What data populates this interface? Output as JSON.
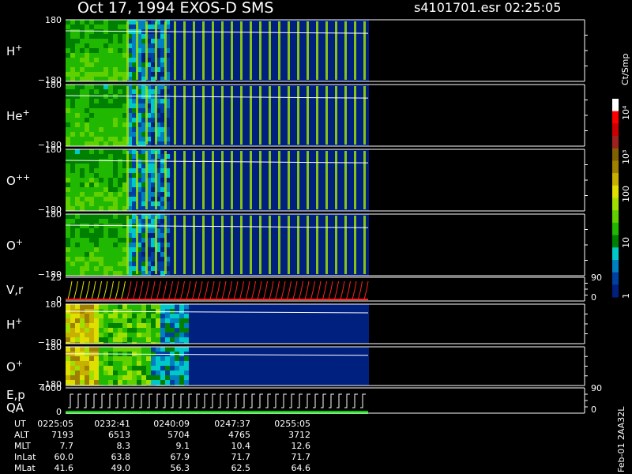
{
  "header": {
    "title": "Oct 17, 1994    EXOS-D SMS",
    "file": "s4101701.esr  02:25:05"
  },
  "colorbar": {
    "unit": "Ct/Smp",
    "ticks": [
      "10⁴",
      "10³",
      "100",
      "10",
      "1"
    ],
    "colors": [
      "#ffffff",
      "#ff0000",
      "#cc0000",
      "#a02020",
      "#806000",
      "#a08000",
      "#c8b000",
      "#e0e000",
      "#a0e000",
      "#60d000",
      "#20b800",
      "#008000",
      "#00c8c8",
      "#0080c0",
      "#0040a0",
      "#002080"
    ]
  },
  "chart_data": {
    "type": "heatmap",
    "title": "Oct 17, 1994    EXOS-D SMS",
    "file": "s4101701.esr  02:25:05",
    "panels": [
      {
        "label": "H",
        "sup": "+",
        "ymax": "180",
        "ymin": "−180"
      },
      {
        "label": "He",
        "sup": "+",
        "ymax": "180",
        "ymin": "−180"
      },
      {
        "label": "O",
        "sup": "++",
        "ymax": "180",
        "ymin": "−180"
      },
      {
        "label": "O",
        "sup": "+",
        "ymax": "180",
        "ymin": "−180"
      },
      {
        "label": "V,r",
        "sup": "",
        "ymax": "25",
        "ymin": "0",
        "right_top": "90",
        "right_bottom": "0"
      },
      {
        "label": "H",
        "sup": "+",
        "ymax": "180",
        "ymin": "−180"
      },
      {
        "label": "O",
        "sup": "+",
        "ymax": "180",
        "ymin": "−180"
      },
      {
        "label": "E,p",
        "label2": "QA",
        "sup": "",
        "ymax": "4000",
        "ymin": "0",
        "right_top": "90",
        "right_bottom": "0"
      }
    ],
    "footer": {
      "rows": [
        {
          "name": "UT",
          "values": [
            "0225:05",
            "0232:41",
            "0240:09",
            "0247:37",
            "0255:05"
          ]
        },
        {
          "name": "ALT",
          "values": [
            "7193",
            "6513",
            "5704",
            "4765",
            "3712"
          ]
        },
        {
          "name": "MLT",
          "values": [
            "7.7",
            "8.3",
            "9.1",
            "10.4",
            "12.6"
          ]
        },
        {
          "name": "InLat",
          "values": [
            "60.0",
            "63.8",
            "67.9",
            "71.7",
            "71.7"
          ]
        },
        {
          "name": "MLat",
          "values": [
            "41.6",
            "49.0",
            "56.3",
            "62.5",
            "64.6"
          ]
        }
      ]
    },
    "side_note": "Feb-01 2AA32L"
  }
}
